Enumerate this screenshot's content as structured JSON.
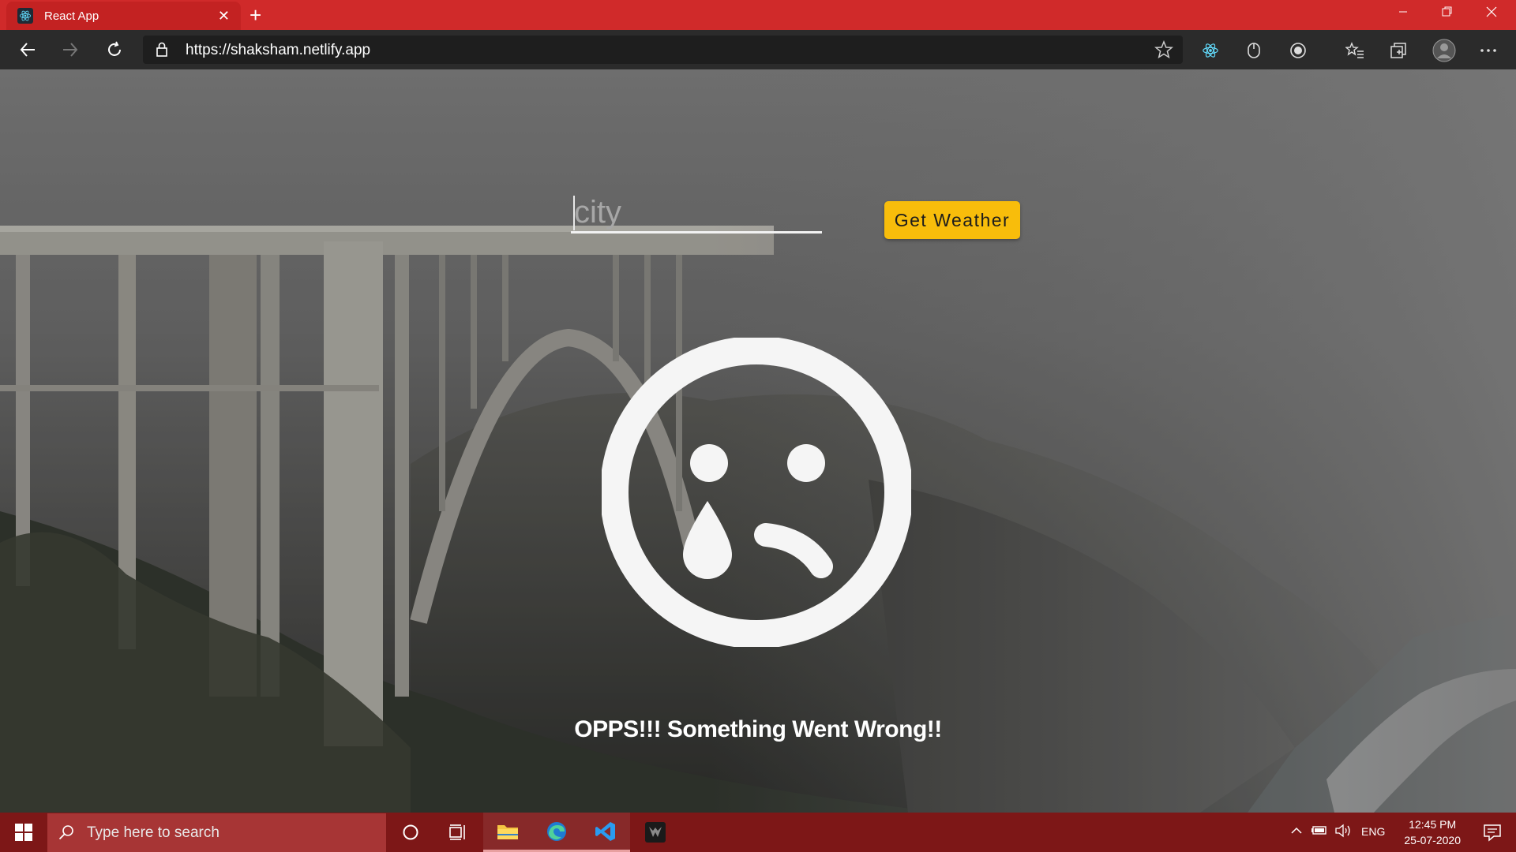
{
  "browser": {
    "tab_title": "React App",
    "url": "https://shaksham.netlify.app"
  },
  "app": {
    "city_placeholder": "city",
    "button_label": "Get Weather",
    "error_message": "OPPS!!! Something Went Wrong!!"
  },
  "taskbar": {
    "search_placeholder": "Type here to search",
    "language": "ENG",
    "time": "12:45 PM",
    "date": "25-07-2020"
  },
  "colors": {
    "title_bar": "#d02a2a",
    "taskbar": "#7d1717",
    "button": "#f8bd0b"
  },
  "icons": [
    "react-icon",
    "back-icon",
    "forward-icon",
    "refresh-icon",
    "lock-icon",
    "star-icon",
    "windows-logo-icon",
    "search-icon",
    "cortana-icon",
    "task-view-icon",
    "file-explorer-icon",
    "edge-icon",
    "vscode-icon",
    "predator-icon",
    "sad-face-icon"
  ]
}
